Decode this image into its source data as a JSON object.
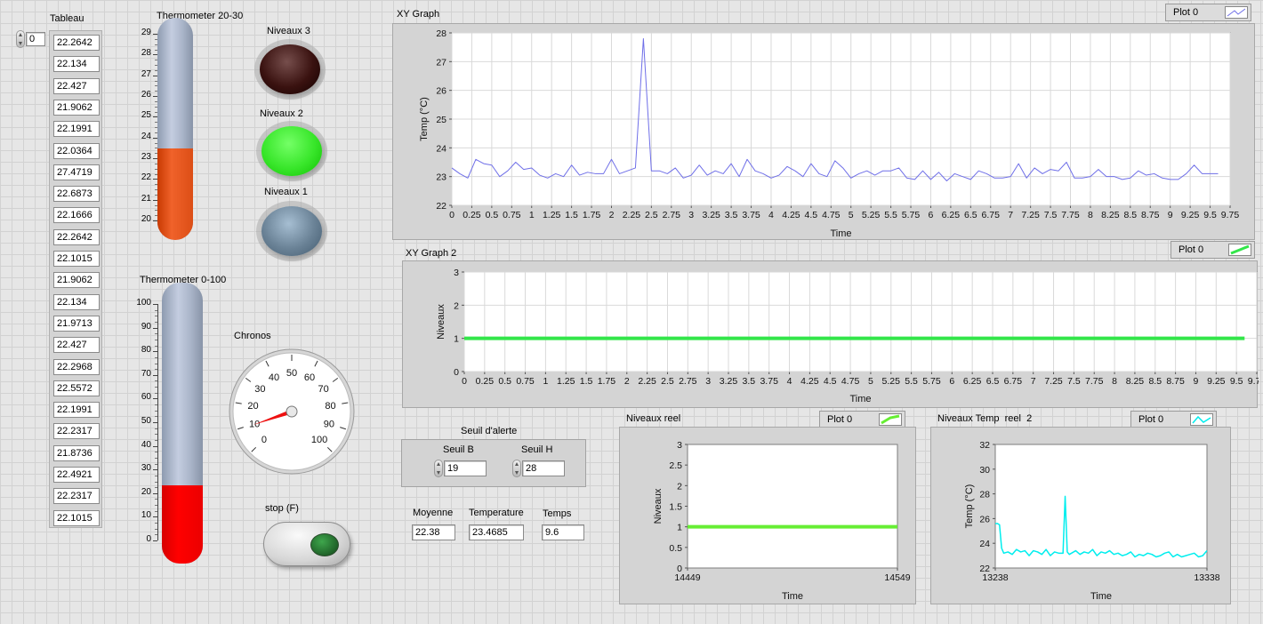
{
  "tableau": {
    "label": "Tableau",
    "index": "0",
    "values": [
      "22.2642",
      "22.134",
      "22.427",
      "21.9062",
      "22.1991",
      "22.0364",
      "27.4719",
      "22.6873",
      "22.1666",
      "22.2642",
      "22.1015",
      "21.9062",
      "22.134",
      "21.9713",
      "22.427",
      "22.2968",
      "22.5572",
      "22.1991",
      "22.2317",
      "21.8736",
      "22.4921",
      "22.2317",
      "22.1015"
    ]
  },
  "thermo1": {
    "label": "Thermometer 20-30",
    "min": 20,
    "max": 29,
    "value": 23.4685,
    "fill_color": "#f0622a",
    "ticks": [
      "29",
      "28",
      "27",
      "26",
      "25",
      "24",
      "23",
      "22",
      "21",
      "20"
    ]
  },
  "thermo2": {
    "label": "Thermometer 0-100",
    "min": 0,
    "max": 100,
    "value": 23.4685,
    "fill_color": "#ff0000",
    "ticks": [
      "100",
      "90",
      "80",
      "70",
      "60",
      "50",
      "40",
      "30",
      "20",
      "10",
      "0"
    ]
  },
  "leds": [
    {
      "label": "Niveaux 3",
      "color": "#3a1210",
      "state": "off"
    },
    {
      "label": "Niveaux 2",
      "color": "#38e62a",
      "state": "on"
    },
    {
      "label": "Niveaux 1",
      "color": "#6a8296",
      "state": "off"
    }
  ],
  "chronos": {
    "label": "Chronos",
    "value": 9.6,
    "min": 0,
    "max": 100,
    "ticks": [
      "0",
      "10",
      "20",
      "30",
      "40",
      "50",
      "60",
      "70",
      "80",
      "90",
      "100"
    ]
  },
  "stop": {
    "label": "stop (F)"
  },
  "seuil": {
    "title": "Seuil d'alerte",
    "seuil_b_label": "Seuil B",
    "seuil_b_value": "19",
    "seuil_h_label": "Seuil H",
    "seuil_h_value": "28"
  },
  "indicators": {
    "moyenne_label": "Moyenne",
    "moyenne_value": "22.38",
    "temperature_label": "Temperature",
    "temperature_value": "23.4685",
    "temps_label": "Temps",
    "temps_value": "9.6"
  },
  "graphs": {
    "xy1": {
      "title": "XY Graph",
      "legend": "Plot 0",
      "xlabel": "Time",
      "ylabel": "Temp (°C)",
      "line_color": "#6f6fe8"
    },
    "xy2": {
      "title": "XY Graph 2",
      "legend": "Plot 0",
      "xlabel": "Time",
      "ylabel": "Niveaux",
      "line_color": "#33e64a"
    },
    "nr": {
      "title": "Niveaux reel",
      "legend": "Plot 0",
      "xlabel": "Time",
      "ylabel": "Niveaux",
      "line_color": "#66ee33"
    },
    "ntr": {
      "title": "Niveaux Temp  reel  2",
      "legend": "Plot 0",
      "xlabel": "Time",
      "ylabel": "Temp (°C)",
      "line_color": "#00eeee"
    }
  },
  "chart_data": [
    {
      "type": "line",
      "title": "XY Graph",
      "xlabel": "Time",
      "ylabel": "Temp (°C)",
      "xlim": [
        0,
        9.75
      ],
      "ylim": [
        22,
        28
      ],
      "xticks": [
        "0",
        "0.25",
        "0.5",
        "0.75",
        "1",
        "1.25",
        "1.5",
        "1.75",
        "2",
        "2.25",
        "2.5",
        "2.75",
        "3",
        "3.25",
        "3.5",
        "3.75",
        "4",
        "4.25",
        "4.5",
        "4.75",
        "5",
        "5.25",
        "5.5",
        "5.75",
        "6",
        "6.25",
        "6.5",
        "6.75",
        "7",
        "7.25",
        "7.5",
        "7.75",
        "8",
        "8.25",
        "8.5",
        "8.75",
        "9",
        "9.25",
        "9.5",
        "9.75"
      ],
      "yticks": [
        "22",
        "23",
        "24",
        "25",
        "26",
        "27",
        "28"
      ],
      "grid": true,
      "series": [
        {
          "name": "Plot 0",
          "x": [
            0,
            0.1,
            0.2,
            0.3,
            0.4,
            0.5,
            0.6,
            0.7,
            0.8,
            0.9,
            1.0,
            1.1,
            1.2,
            1.3,
            1.4,
            1.5,
            1.6,
            1.7,
            1.8,
            1.9,
            2.0,
            2.1,
            2.2,
            2.3,
            2.4,
            2.5,
            2.6,
            2.7,
            2.8,
            2.9,
            3.0,
            3.1,
            3.2,
            3.3,
            3.4,
            3.5,
            3.6,
            3.7,
            3.8,
            3.9,
            4.0,
            4.1,
            4.2,
            4.3,
            4.4,
            4.5,
            4.6,
            4.7,
            4.8,
            4.9,
            5.0,
            5.1,
            5.2,
            5.3,
            5.4,
            5.5,
            5.6,
            5.7,
            5.8,
            5.9,
            6.0,
            6.1,
            6.2,
            6.3,
            6.4,
            6.5,
            6.6,
            6.7,
            6.8,
            6.9,
            7.0,
            7.1,
            7.2,
            7.3,
            7.4,
            7.5,
            7.6,
            7.7,
            7.8,
            7.9,
            8.0,
            8.1,
            8.2,
            8.3,
            8.4,
            8.5,
            8.6,
            8.7,
            8.8,
            8.9,
            9.0,
            9.1,
            9.2,
            9.3,
            9.4,
            9.5,
            9.6
          ],
          "y": [
            23.3,
            23.1,
            22.95,
            23.6,
            23.45,
            23.4,
            23.0,
            23.2,
            23.5,
            23.25,
            23.3,
            23.05,
            22.95,
            23.1,
            23.0,
            23.4,
            23.05,
            23.15,
            23.1,
            23.1,
            23.6,
            23.1,
            23.2,
            23.3,
            27.8,
            23.2,
            23.2,
            23.1,
            23.3,
            22.95,
            23.05,
            23.4,
            23.05,
            23.2,
            23.1,
            23.45,
            23.0,
            23.6,
            23.2,
            23.1,
            22.95,
            23.05,
            23.35,
            23.2,
            23.0,
            23.45,
            23.1,
            23.0,
            23.55,
            23.3,
            22.95,
            23.1,
            23.2,
            23.05,
            23.2,
            23.2,
            23.3,
            22.95,
            22.9,
            23.2,
            22.9,
            23.15,
            22.85,
            23.1,
            23.0,
            22.9,
            23.2,
            23.1,
            22.95,
            22.95,
            23.0,
            23.45,
            22.95,
            23.3,
            23.1,
            23.25,
            23.2,
            23.5,
            22.95,
            22.95,
            23.0,
            23.25,
            23.0,
            23.0,
            22.9,
            22.95,
            23.2,
            23.05,
            23.1,
            22.95,
            22.9,
            22.9,
            23.1,
            23.4,
            23.1,
            23.1,
            23.1
          ]
        }
      ]
    },
    {
      "type": "line",
      "title": "XY Graph 2",
      "xlabel": "Time",
      "ylabel": "Niveaux",
      "xlim": [
        0,
        9.75
      ],
      "ylim": [
        0,
        3
      ],
      "xticks": [
        "0",
        "0.25",
        "0.5",
        "0.75",
        "1",
        "1.25",
        "1.5",
        "1.75",
        "2",
        "2.25",
        "2.5",
        "2.75",
        "3",
        "3.25",
        "3.5",
        "3.75",
        "4",
        "4.25",
        "4.5",
        "4.75",
        "5",
        "5.25",
        "5.5",
        "5.75",
        "6",
        "6.25",
        "6.5",
        "6.75",
        "7",
        "7.25",
        "7.5",
        "7.75",
        "8",
        "8.25",
        "8.5",
        "8.75",
        "9",
        "9.25",
        "9.5",
        "9.75"
      ],
      "yticks": [
        "0",
        "1",
        "2",
        "3"
      ],
      "grid": true,
      "series": [
        {
          "name": "Plot 0",
          "x": [
            0,
            9.6
          ],
          "y": [
            1,
            1
          ]
        }
      ]
    },
    {
      "type": "line",
      "title": "Niveaux reel",
      "xlabel": "Time",
      "ylabel": "Niveaux",
      "xlim": [
        14449,
        14549
      ],
      "ylim": [
        0,
        3
      ],
      "xticks": [
        "14449",
        "14549"
      ],
      "yticks": [
        "0",
        "0.5",
        "1",
        "1.5",
        "2",
        "2.5",
        "3"
      ],
      "grid": false,
      "series": [
        {
          "name": "Plot 0",
          "x": [
            14449,
            14549
          ],
          "y": [
            1,
            1
          ]
        }
      ]
    },
    {
      "type": "line",
      "title": "Niveaux Temp  reel  2",
      "xlabel": "Time",
      "ylabel": "Temp (°C)",
      "xlim": [
        13238,
        13338
      ],
      "ylim": [
        22,
        32
      ],
      "xticks": [
        "13238",
        "13338"
      ],
      "yticks": [
        "22",
        "24",
        "26",
        "28",
        "30",
        "32"
      ],
      "grid": false,
      "series": [
        {
          "name": "Plot 0",
          "x": [
            13238,
            13239,
            13240,
            13241,
            13242,
            13244,
            13246,
            13248,
            13250,
            13252,
            13254,
            13256,
            13258,
            13260,
            13262,
            13264,
            13266,
            13268,
            13270,
            13271,
            13272,
            13273,
            13274,
            13276,
            13278,
            13280,
            13282,
            13284,
            13286,
            13288,
            13290,
            13292,
            13294,
            13296,
            13298,
            13300,
            13302,
            13304,
            13306,
            13308,
            13310,
            13312,
            13314,
            13316,
            13318,
            13320,
            13322,
            13324,
            13326,
            13328,
            13330,
            13332,
            13334,
            13336,
            13338
          ],
          "y": [
            25.6,
            25.6,
            25.5,
            23.6,
            23.2,
            23.3,
            23.1,
            23.5,
            23.3,
            23.4,
            23.0,
            23.4,
            23.3,
            23.1,
            23.5,
            23.0,
            23.3,
            23.2,
            23.2,
            27.8,
            23.3,
            23.1,
            23.2,
            23.4,
            23.1,
            23.3,
            23.2,
            23.5,
            23.0,
            23.3,
            23.2,
            23.4,
            23.1,
            23.2,
            23.0,
            23.1,
            23.3,
            22.9,
            23.1,
            23.0,
            23.2,
            23.1,
            22.9,
            23.0,
            23.2,
            23.3,
            22.9,
            23.1,
            22.9,
            23.0,
            23.1,
            23.2,
            22.9,
            23.0,
            23.4
          ]
        }
      ]
    }
  ]
}
